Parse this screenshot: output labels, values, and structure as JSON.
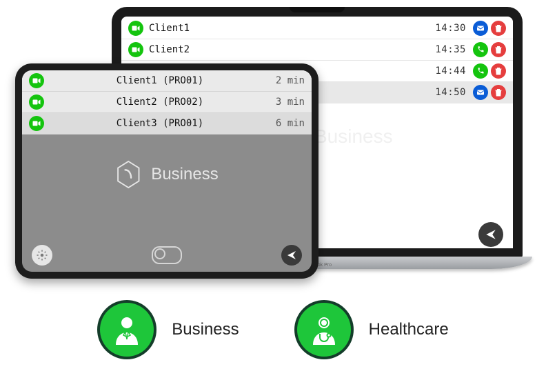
{
  "laptop": {
    "brand_text": "MacBook Pro",
    "watermark": "Business",
    "rows": [
      {
        "name": "Client1",
        "time": "14:30",
        "action": "mail",
        "selected": false
      },
      {
        "name": "Client2",
        "time": "14:35",
        "action": "phone",
        "selected": false
      },
      {
        "name": "",
        "time": "14:44",
        "action": "phone",
        "selected": false
      },
      {
        "name": "",
        "time": "14:50",
        "action": "mail",
        "selected": true
      }
    ],
    "toggle_on": true
  },
  "tablet": {
    "brand": "Business",
    "rows": [
      {
        "name": "Client1 (PRO01)",
        "duration": "2 min",
        "selected": false
      },
      {
        "name": "Client2 (PRO02)",
        "duration": "3 min",
        "selected": false
      },
      {
        "name": "Client3 (PRO01)",
        "duration": "6 min",
        "selected": true
      }
    ]
  },
  "badges": {
    "business": {
      "label": "Business"
    },
    "healthcare": {
      "label": "Healthcare"
    }
  }
}
